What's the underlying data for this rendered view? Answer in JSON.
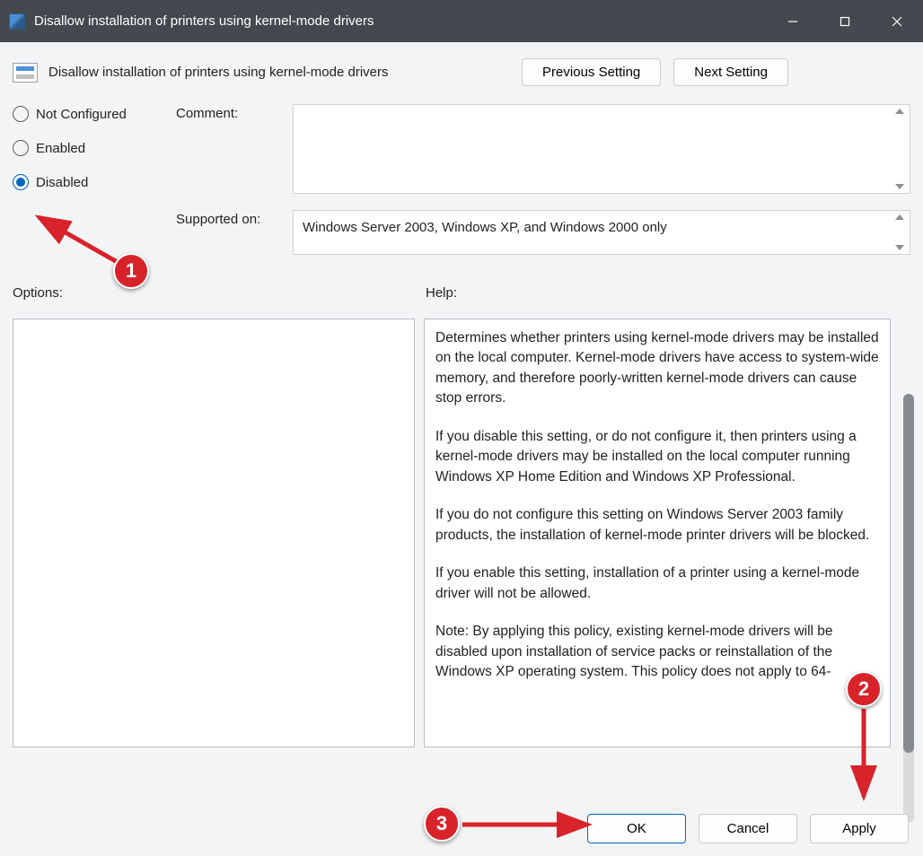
{
  "window": {
    "title": "Disallow installation of printers using kernel-mode drivers"
  },
  "header": {
    "policy_name": "Disallow installation of printers using kernel-mode drivers",
    "prev_label": "Previous Setting",
    "next_label": "Next Setting"
  },
  "state": {
    "options": {
      "not_configured": "Not Configured",
      "enabled": "Enabled",
      "disabled": "Disabled"
    },
    "selected": "disabled"
  },
  "fields": {
    "comment_label": "Comment:",
    "comment_value": "",
    "supported_label": "Supported on:",
    "supported_value": "Windows Server 2003, Windows XP, and Windows 2000 only"
  },
  "labels": {
    "options": "Options:",
    "help": "Help:"
  },
  "help": {
    "p1": "Determines whether printers using kernel-mode drivers may be installed on the local computer.  Kernel-mode drivers have access to system-wide memory, and therefore poorly-written kernel-mode drivers can cause stop errors.",
    "p2": "If you disable this setting, or do not configure it, then printers using a kernel-mode drivers may be installed on the local computer running Windows XP Home Edition and Windows XP Professional.",
    "p3": "If you do not configure this setting on Windows Server 2003 family products, the installation of kernel-mode printer drivers will be blocked.",
    "p4": "If you enable this setting, installation of a printer using a kernel-mode driver will not be allowed.",
    "p5": "Note: By applying this policy, existing kernel-mode drivers will be disabled upon installation of service packs or reinstallation of the Windows XP operating system. This policy does not apply to 64-"
  },
  "footer": {
    "ok": "OK",
    "cancel": "Cancel",
    "apply": "Apply"
  },
  "annotations": {
    "m1": "1",
    "m2": "2",
    "m3": "3"
  }
}
